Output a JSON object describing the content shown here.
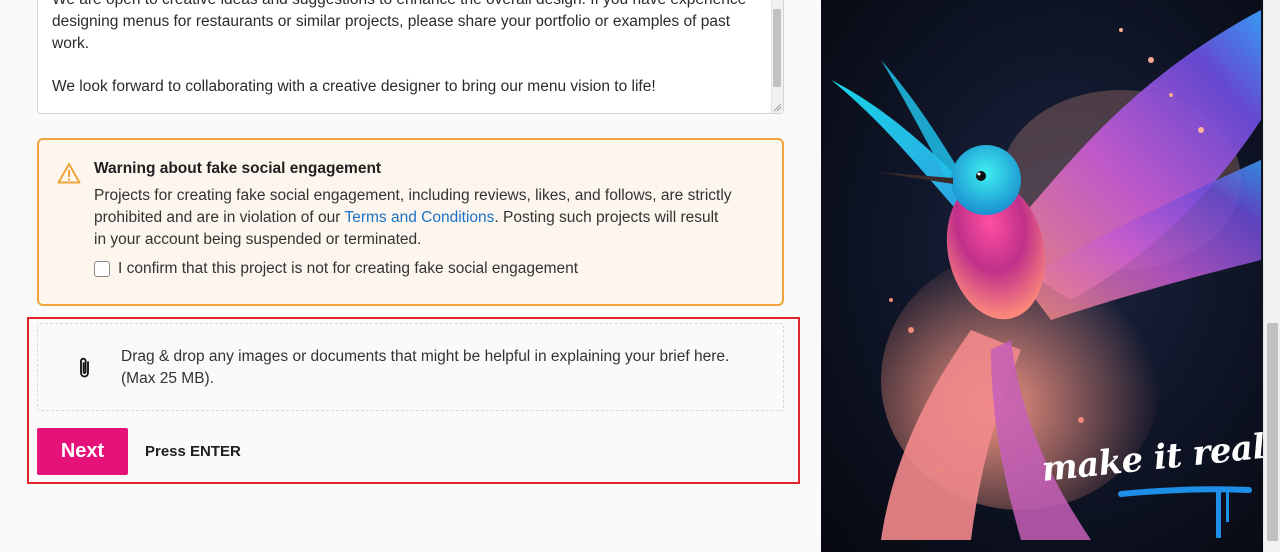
{
  "brief": {
    "lines": [
      "We are open to creative ideas and suggestions to enhance the overall design. If you have experience",
      "designing menus for restaurants or similar projects, please share your portfolio or examples of past",
      "work."
    ],
    "closing": "We look forward to collaborating with a creative designer to bring our menu vision to life!"
  },
  "warning": {
    "title": "Warning about fake social engagement",
    "body_before_link": "Projects for creating fake social engagement, including reviews, likes, and follows, are strictly prohibited and are in violation of our ",
    "link_text": "Terms and Conditions",
    "body_after_link": ". Posting such projects will result in your account being suspended or terminated.",
    "confirm_label": "I confirm that this project is not for creating fake social engagement",
    "accent_color": "#f0a43c"
  },
  "upload": {
    "line1": "Drag & drop any images or documents that might be helpful in explaining your brief here.",
    "line2": "(Max 25 MB)."
  },
  "actions": {
    "next_label": "Next",
    "hint": "Press ENTER",
    "brand_color": "#e5127a"
  },
  "art": {
    "tagline": "make it real."
  },
  "icons": {
    "warning": "warning-triangle-icon",
    "attach": "paperclip-icon"
  }
}
